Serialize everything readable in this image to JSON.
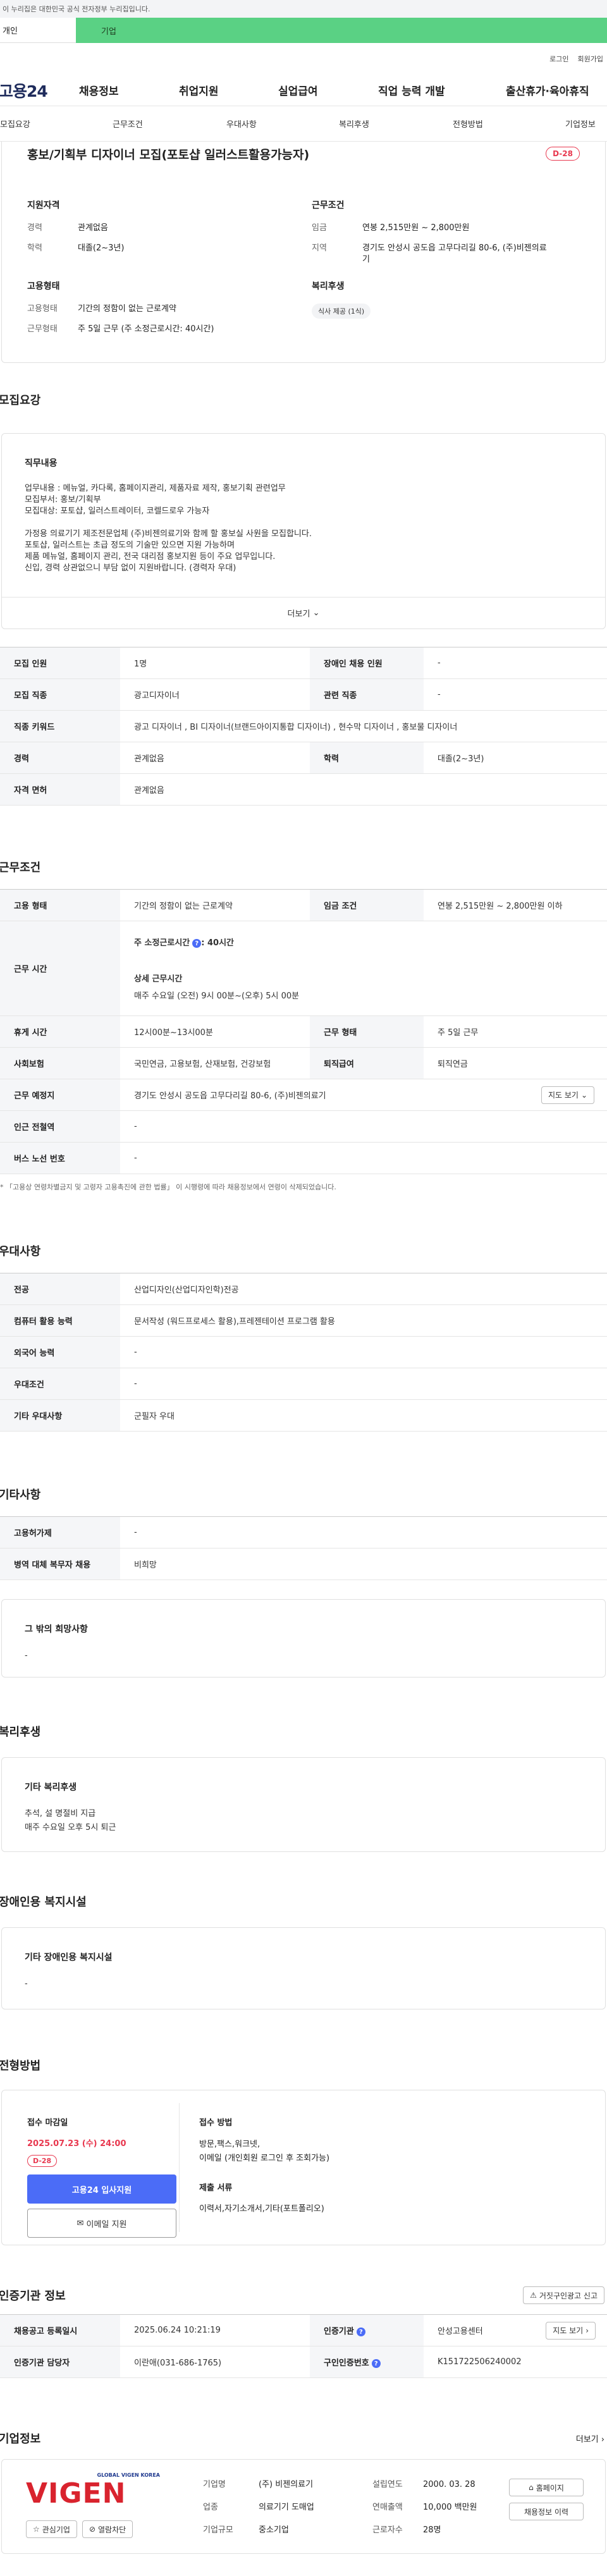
{
  "gov_banner": "이 누리집은 대한민국 공식 전자정부 누리집입니다.",
  "site_tabs": {
    "personal": "개인",
    "company": "기업"
  },
  "util": {
    "login": "로그인",
    "join": "회원가입"
  },
  "logo": "고용24",
  "gnb": [
    "채용정보",
    "취업지원",
    "실업급여",
    "직업 능력 개발",
    "출산휴가·육아휴직"
  ],
  "lnb": [
    "모집요강",
    "근무조건",
    "우대사항",
    "복리후생",
    "전형방법",
    "기업정보"
  ],
  "job": {
    "title": "홍보/기획부 디자이너 모집(포토샵 일러스트활용가능자)",
    "dday": "D-28",
    "qual_title": "지원자격",
    "career_k": "경력",
    "career_v": "관계없음",
    "edu_k": "학력",
    "edu_v": "대졸(2~3년)",
    "cond_title": "근무조건",
    "wage_k": "임금",
    "wage_v": "연봉 2,515만원 ~ 2,800만원",
    "area_k": "지역",
    "area_v1": "경기도 안성시 공도읍 고무다리길 80-6, (주)비젠의료",
    "area_v2": "기",
    "emp_title": "고용형태",
    "emp_k": "고용형태",
    "emp_v": "기간의 정함이 없는 근로계약",
    "work_k": "근무형태",
    "work_v": "주 5일 근무 (주 소정근로시간: 40시간)",
    "welfare_title": "복리후생",
    "welfare_chip": "식사 제공 (1식)"
  },
  "recruit": {
    "section": "모집요강",
    "sub": "직무내용",
    "lines": [
      "업무내용 : 메뉴얼, 카다록, 홈페이지관리, 제품자료 제작, 홍보기획 관련업무",
      "모집부서: 홍보/기획부",
      "모집대상: 포토샵, 일러스트레이터, 코렐드로우 가능자",
      "",
      "가정용 의료기기 제조전문업체 (주)비젠의료기와 함께 할 홍보실 사원을 모집합니다.",
      "포토샵, 일러스트는 초급 정도의 기술만 있으면 지원 가능하며",
      "제품 메뉴얼, 홈페이지 관리, 전국 대리점 홍보지원 등이 주요 업무입니다.",
      "신입, 경력 상관없으니 부담 없이 지원바랍니다. (경력자 우대)"
    ],
    "more": "더보기"
  },
  "recruit_table": [
    [
      "모집 인원",
      "1명",
      "장애인 채용 인원",
      "-"
    ],
    [
      "모집 직종",
      "광고디자이너",
      "관련 직종",
      "-"
    ],
    [
      "직종 키워드",
      "광고 디자이너 , BI 디자이너(브랜드아이지통합 디자이너) , 현수막 디자이너 , 홍보물 디자이너",
      "",
      ""
    ],
    [
      "경력",
      "관계없음",
      "학력",
      "대졸(2~3년)"
    ],
    [
      "자격 면허",
      "관계없음",
      "",
      ""
    ]
  ],
  "conditions": {
    "section": "근무조건",
    "emp_k": "고용 형태",
    "emp_v": "기간의 정함이 없는 근로계약",
    "wage_k": "임금 조건",
    "wage_v": "연봉 2,515만원 ~ 2,800만원 이하",
    "hours_k": "근무 시간",
    "hours_week": "주 소정근로시간",
    "hours_week_v": ": 40시간",
    "hours_detail_t": "상세 근무시간",
    "hours_detail_v": "매주 수요일 (오전) 9시 00분~(오후) 5시 00분",
    "rest_k": "휴게 시간",
    "rest_v": "12시00분~13시00분",
    "shape_k": "근무 형태",
    "shape_v": "주 5일 근무",
    "ins_k": "사회보험",
    "ins_v": "국민연금, 고용보험, 산재보험, 건강보험",
    "retire_k": "퇴직급여",
    "retire_v": "퇴직연금",
    "place_k": "근무 예정지",
    "place_v": "경기도 안성시 공도읍 고무다리길 80-6, (주)비젠의료기",
    "map_btn": "지도 보기",
    "subway_k": "인근 전철역",
    "subway_v": "-",
    "bus_k": "버스 노선 번호",
    "bus_v": "-",
    "note": "* 「고용상 연령차별금지 및 고령자 고용촉진에 관한 법률」 이 시행령에 따라 채용정보에서 연령이 삭제되었습니다."
  },
  "pref": {
    "section": "우대사항",
    "rows": [
      [
        "전공",
        "산업디자인(산업디자인학)전공"
      ],
      [
        "컴퓨터 활용 능력",
        "문서작성 (워드프로세스 활용),프레젠테이션 프로그램 활용"
      ],
      [
        "외국어 능력",
        "-"
      ],
      [
        "우대조건",
        "-"
      ],
      [
        "기타 우대사항",
        "군필자 우대"
      ]
    ]
  },
  "etc": {
    "section": "기타사항",
    "rows": [
      [
        "고용허가제",
        "-"
      ],
      [
        "병역 대체 복무자 채용",
        "비희망"
      ]
    ],
    "hope_t": "그 밖의 희망사항",
    "hope_v": "-"
  },
  "benefit": {
    "section": "복리후생",
    "sub": "기타 복리후생",
    "lines": [
      "추석, 설 명절비 지급",
      "매주 수요일 오후 5시 퇴근"
    ]
  },
  "disabled": {
    "section": "장애인용 복지시설",
    "sub": "기타 장애인용 복지시설",
    "value": "-"
  },
  "process": {
    "section": "전형방법",
    "deadline_t": "접수 마감일",
    "deadline_v": "2025.07.23 (수) 24:00",
    "dday": "D-28",
    "apply_btn": "고용24 입사지원",
    "email_btn": "이메일 지원",
    "method_t": "접수 방법",
    "method_v1": "방문,팩스,워크넷,",
    "method_v2": "이메일 (개인회원 로그인 후 조회가능)",
    "docs_t": "제출 서류",
    "docs_v": "이력서,자기소개서,기타(포트폴리오)"
  },
  "cert": {
    "section": "인증기관 정보",
    "report_btn": "거짓구인광고 신고",
    "reg_k": "채용공고 등록일시",
    "reg_v": "2025.06.24 10:21:19",
    "org_k": "인증기관",
    "org_v": "안성고용센터",
    "map_btn": "지도 보기",
    "mgr_k": "인증기관 담당자",
    "mgr_v": "이란애(031-686-1765)",
    "num_k": "구인인증번호",
    "num_v": "K151722506240002"
  },
  "company": {
    "section": "기업정보",
    "more": "더보기",
    "logo_sub": "GLOBAL VIGEN KOREA",
    "logo_text": "VIGEN",
    "like_btn": "관심기업",
    "block_btn": "열람차단",
    "name_k": "기업명",
    "name_v": "(주) 비젠의료기",
    "year_k": "설립연도",
    "year_v": "2000. 03. 28",
    "type_k": "업종",
    "type_v": "의료기기 도매업",
    "sales_k": "연매출액",
    "sales_v": "10,000 백만원",
    "size_k": "기업규모",
    "size_v": "중소기업",
    "staff_k": "근로자수",
    "staff_v": "28명",
    "home_btn": "홈페이지",
    "jobs_btn": "채용정보 이력"
  },
  "colors": {
    "accent": "#4b6cf7",
    "dday": "#e8384f",
    "green": "#5ad184",
    "logo_red": "#d9232e",
    "logo_blue": "#203a8f"
  }
}
